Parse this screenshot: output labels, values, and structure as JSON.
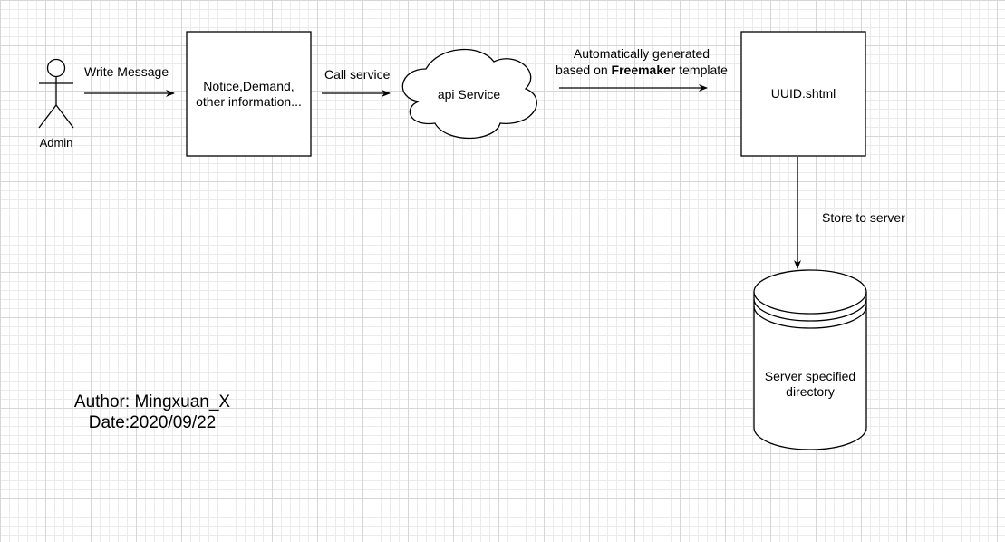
{
  "actor": {
    "label": "Admin"
  },
  "edges": {
    "write_message": "Write Message",
    "call_service": "Call service",
    "generated_line1": "Automatically generated",
    "generated_prefix": "based on ",
    "generated_bold": "Freemaker",
    "generated_suffix": " template",
    "store": "Store to server"
  },
  "nodes": {
    "info_box_line1": "Notice,Demand,",
    "info_box_line2": "other information...",
    "api_service": "api Service",
    "uuid_file": "UUID.shtml",
    "server_dir_line1": "Server specified",
    "server_dir_line2": "directory"
  },
  "footer": {
    "author": "Author: Mingxuan_X",
    "date": "Date:2020/09/22"
  },
  "colors": {
    "stroke": "#000000",
    "fill": "#ffffff",
    "grid_minor": "#ebebeb",
    "grid_major": "#d6d6d6",
    "page_guide": "#c0c0c0"
  }
}
